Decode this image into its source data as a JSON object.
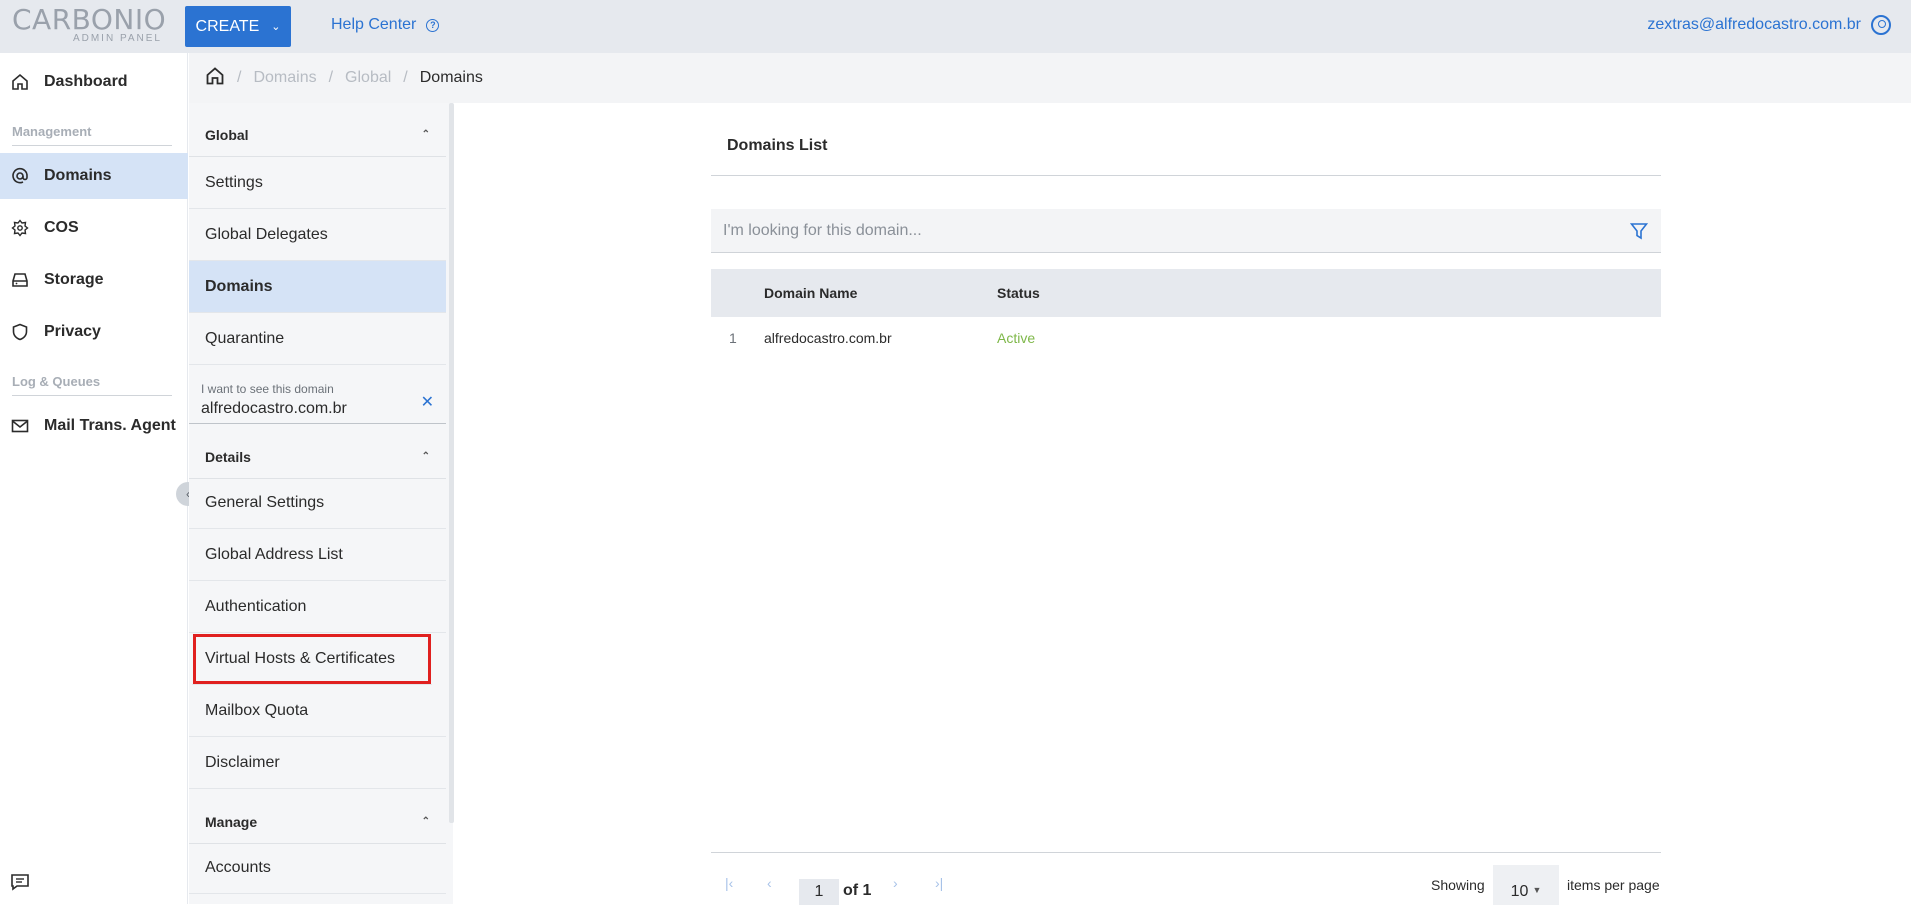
{
  "header": {
    "logo_main": "CARBONIO",
    "logo_sub": "ADMIN PANEL",
    "create_label": "CREATE",
    "help_label": "Help Center",
    "user_email": "zextras@alfredocastro.com.br"
  },
  "leftnav": {
    "items": [
      {
        "label": "Dashboard",
        "icon": "home-icon"
      },
      {
        "label": "Domains",
        "icon": "at-icon"
      },
      {
        "label": "COS",
        "icon": "cos-icon"
      },
      {
        "label": "Storage",
        "icon": "storage-icon"
      },
      {
        "label": "Privacy",
        "icon": "shield-icon"
      },
      {
        "label": "Mail Trans. Agent",
        "icon": "mail-icon"
      }
    ],
    "sections": [
      "Management",
      "Log & Queues"
    ]
  },
  "breadcrumb": [
    "Domains",
    "Global",
    "Domains"
  ],
  "subnav": {
    "global_header": "Global",
    "global_items": [
      "Settings",
      "Global Delegates",
      "Domains",
      "Quarantine"
    ],
    "domain_field_label": "I want to see this domain",
    "domain_field_value": "alfredocastro.com.br",
    "details_header": "Details",
    "details_items": [
      "General Settings",
      "Global Address List",
      "Authentication",
      "Virtual Hosts & Certificates",
      "Mailbox Quota",
      "Disclaimer"
    ],
    "manage_header": "Manage",
    "manage_items": [
      "Accounts"
    ]
  },
  "main": {
    "title": "Domains List",
    "search_placeholder": "I'm looking for this domain...",
    "columns": [
      "Domain Name",
      "Status"
    ],
    "rows": [
      {
        "index": "1",
        "name": "alfredocastro.com.br",
        "status": "Active"
      }
    ],
    "pagination": {
      "page": "1",
      "of": "of 1",
      "showing": "Showing",
      "per_page": "10",
      "items_per_page": "items per page"
    }
  },
  "colors": {
    "accent": "#2b73d2",
    "active_bg": "#d5e3f6",
    "status_active": "#7fb84a",
    "highlight": "#e0201f"
  }
}
